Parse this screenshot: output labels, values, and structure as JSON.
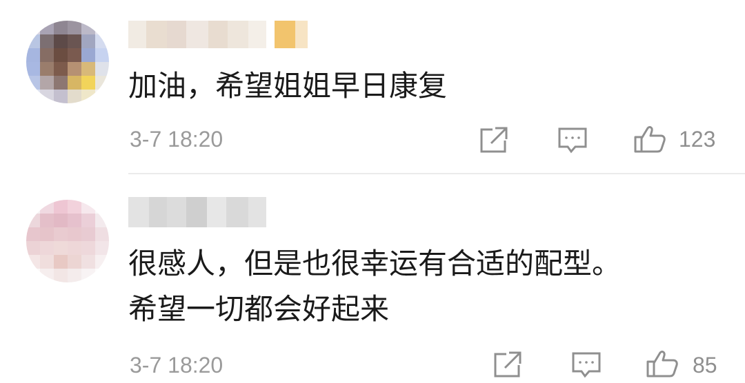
{
  "comments": [
    {
      "text": "加油，希望姐姐早日康复",
      "time": "3-7 18:20",
      "like_count": "123"
    },
    {
      "text_lines": [
        "很感人，但是也很幸运有合适的配型。",
        "希望一切都会好起来"
      ],
      "time": "3-7 18:20",
      "like_count": "85"
    }
  ],
  "icons": {
    "share": "share-icon",
    "reply": "comment-icon",
    "like": "thumbs-up-icon"
  },
  "colors": {
    "text": "#1a1a1a",
    "meta": "#9a9a9a",
    "icon": "#8f8f8f",
    "divider": "#ebebeb"
  }
}
